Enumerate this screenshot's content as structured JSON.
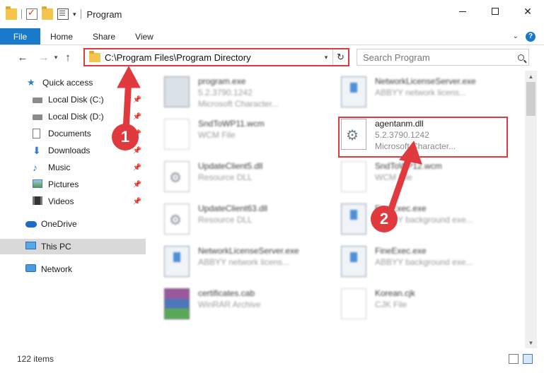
{
  "window": {
    "title": "Program"
  },
  "ribbon": {
    "tabs": [
      "File",
      "Home",
      "Share",
      "View"
    ]
  },
  "address": {
    "path": "C:\\Program Files\\Program Directory"
  },
  "search": {
    "placeholder": "Search Program"
  },
  "sidebar": {
    "items": [
      {
        "label": "Quick access",
        "icon": "star-icon",
        "pinned": false
      },
      {
        "label": "Local Disk (C:)",
        "icon": "drive-icon",
        "pinned": true
      },
      {
        "label": "Local Disk (D:)",
        "icon": "drive-icon",
        "pinned": true
      },
      {
        "label": "Documents",
        "icon": "documents-icon",
        "pinned": true
      },
      {
        "label": "Downloads",
        "icon": "downloads-icon",
        "pinned": true
      },
      {
        "label": "Music",
        "icon": "music-icon",
        "pinned": true
      },
      {
        "label": "Pictures",
        "icon": "pictures-icon",
        "pinned": true
      },
      {
        "label": "Videos",
        "icon": "videos-icon",
        "pinned": true
      },
      {
        "label": "OneDrive",
        "icon": "onedrive-icon",
        "pinned": false
      },
      {
        "label": "This PC",
        "icon": "this-pc-icon",
        "pinned": false,
        "selected": true
      },
      {
        "label": "Network",
        "icon": "network-icon",
        "pinned": false
      }
    ]
  },
  "files": [
    {
      "name": "program.exe",
      "line2": "5.2.3790.1242",
      "line3": "Microsoft Character...",
      "icon": "setup-icon",
      "blurred": true
    },
    {
      "name": "NetworkLicenseServer.exe",
      "line2": "ABBYY network licens...",
      "line3": "",
      "icon": "exe-icon",
      "blurred": true
    },
    {
      "name": "SndToWP11.wcm",
      "line2": "WCM File",
      "line3": "",
      "icon": "page-icon",
      "blurred": true
    },
    {
      "name": "agentanm.dll",
      "line2": "5.2.3790.1242",
      "line3": "Microsoft Character...",
      "icon": "gear-icon",
      "blurred": false
    },
    {
      "name": "UpdateClient5.dll",
      "line2": "Resource DLL",
      "line3": "",
      "icon": "gear-icon",
      "blurred": true
    },
    {
      "name": "SndToWP12.wcm",
      "line2": "WCM File",
      "line3": "",
      "icon": "page-icon",
      "blurred": true
    },
    {
      "name": "UpdateClient63.dll",
      "line2": "Resource DLL",
      "line3": "",
      "icon": "gear-icon",
      "blurred": true
    },
    {
      "name": "FineExec.exe",
      "line2": "ABBYY background exe...",
      "line3": "",
      "icon": "exe-icon",
      "blurred": true
    },
    {
      "name": "NetworkLicenseServer.exe",
      "line2": "ABBYY network licens...",
      "line3": "",
      "icon": "exe-icon",
      "blurred": true
    },
    {
      "name": "FineExec.exe",
      "line2": "ABBYY background exe...",
      "line3": "",
      "icon": "exe-icon",
      "blurred": true
    },
    {
      "name": "certificates.cab",
      "line2": "WinRAR Archive",
      "line3": "",
      "icon": "archive-icon",
      "blurred": true
    },
    {
      "name": "Korean.cjk",
      "line2": "CJK File",
      "line3": "",
      "icon": "page-icon",
      "blurred": true
    }
  ],
  "status": {
    "item_count": "122 items"
  },
  "annotations": {
    "badge1": "1",
    "badge2": "2",
    "color": "#e0393e"
  }
}
